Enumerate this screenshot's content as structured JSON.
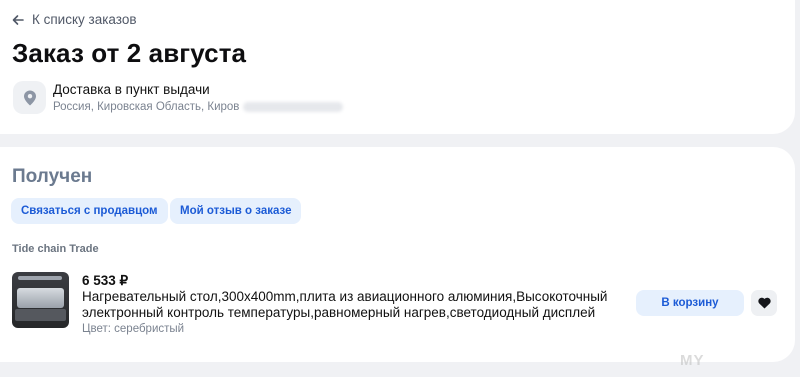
{
  "header": {
    "back_label": "К списку заказов",
    "title": "Заказ от 2 августа"
  },
  "delivery": {
    "icon": "map-pin-icon",
    "title": "Доставка в пункт выдачи",
    "address": "Россия, Кировская Область, Киров"
  },
  "order": {
    "status": "Получен",
    "contact_seller_label": "Связаться с продавцом",
    "review_label": "Мой отзыв о заказе",
    "seller": "Tide chain Trade",
    "item": {
      "price": "6 533 ₽",
      "name": "Нагревательный стол,300x400mm,плита из авиационного алюминия,Высокоточный электронный контроль температуры,равномерный нагрев,светодиодный дисплей",
      "color": "Цвет: серебристый",
      "cart_label": "В корзину",
      "fav_icon": "heart-icon"
    }
  },
  "colors": {
    "accent": "#1c5bd6",
    "pill_bg": "#e6f0fd",
    "status": "#6b7a8f"
  },
  "watermark": "MY"
}
